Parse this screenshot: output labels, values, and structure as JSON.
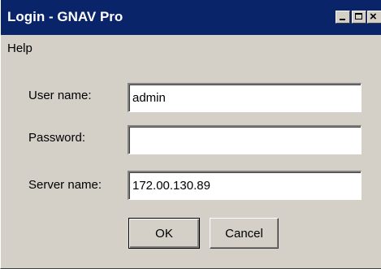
{
  "window": {
    "title": "Login - GNAV Pro",
    "controls": {
      "minimize": "minimize-icon",
      "maximize": "maximize-icon",
      "close": "×"
    }
  },
  "menu": {
    "items": [
      {
        "label": "Help"
      }
    ]
  },
  "form": {
    "username": {
      "label": "User name:",
      "value": "admin"
    },
    "password": {
      "label": "Password:",
      "value": ""
    },
    "server": {
      "label": "Server name:",
      "value": "172.00.130.89"
    }
  },
  "buttons": {
    "ok": "OK",
    "cancel": "Cancel"
  },
  "colors": {
    "titlebar": "#0a246a",
    "face": "#d4d0c8",
    "title_text": "#ffffff"
  }
}
